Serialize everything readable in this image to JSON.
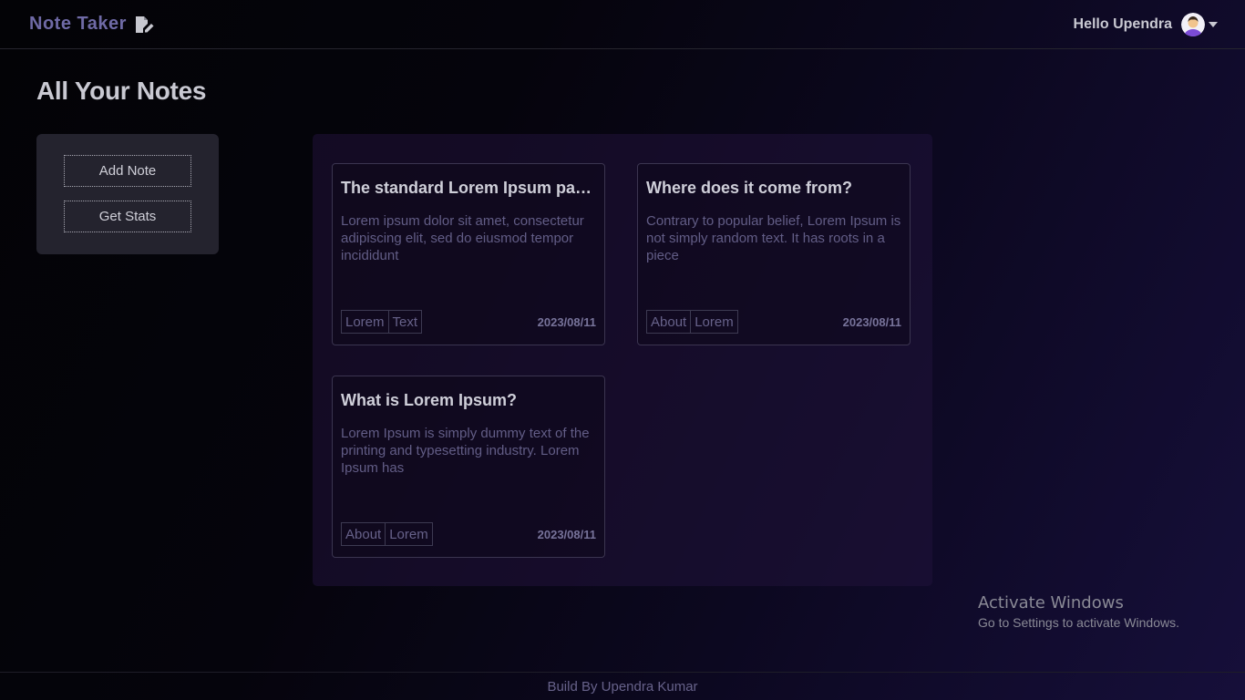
{
  "navbar": {
    "brand": "Note Taker",
    "brand_icon": "note-edit-icon",
    "greeting": "Hello Upendra",
    "avatar_icon": "user-avatar-icon",
    "menu_icon": "caret-down-icon"
  },
  "page": {
    "title": "All Your Notes"
  },
  "sidebar": {
    "add_note_label": "Add Note",
    "get_stats_label": "Get Stats"
  },
  "notes": [
    {
      "title": "The standard Lorem Ipsum passa...",
      "body": "Lorem ipsum dolor sit amet, consectetur adipiscing elit, sed do eiusmod tempor incididunt",
      "tags": [
        "Lorem",
        "Text"
      ],
      "date": "2023/08/11"
    },
    {
      "title": "Where does it come from?",
      "body": "Contrary to popular belief, Lorem Ipsum is not simply random text. It has roots in a piece",
      "tags": [
        "About",
        "Lorem"
      ],
      "date": "2023/08/11"
    },
    {
      "title": "What is Lorem Ipsum?",
      "body": "Lorem Ipsum is simply dummy text of the printing and typesetting industry. Lorem Ipsum has",
      "tags": [
        "About",
        "Lorem"
      ],
      "date": "2023/08/11"
    }
  ],
  "footer": {
    "text": "Build By Upendra Kumar"
  },
  "watermark": {
    "title": "Activate Windows",
    "subtitle": "Go to Settings to activate Windows."
  },
  "colors": {
    "brand": "#6f6aa6",
    "panel": "#24232e",
    "accent_text": "#625d86"
  }
}
